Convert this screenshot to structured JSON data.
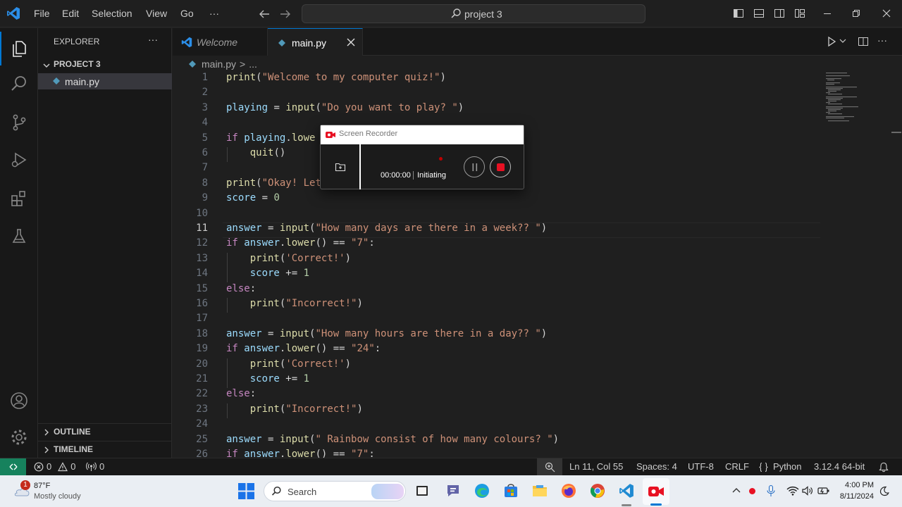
{
  "titlebar": {
    "menu": [
      "File",
      "Edit",
      "Selection",
      "View",
      "Go",
      "···"
    ],
    "search": "project 3"
  },
  "sidebar": {
    "title": "EXPLORER",
    "more": "···",
    "project": "PROJECT 3",
    "files": [
      "main.py"
    ],
    "outline": "OUTLINE",
    "timeline": "TIMELINE"
  },
  "tabs": [
    {
      "label": "Welcome",
      "active": false
    },
    {
      "label": "main.py",
      "active": true
    }
  ],
  "breadcrumb": {
    "file": "main.py",
    "sep": ">",
    "rest": "..."
  },
  "editor": {
    "active_line": 11,
    "lines": [
      {
        "n": "1",
        "t": [
          [
            "print",
            "f"
          ],
          [
            "(",
            "o"
          ],
          [
            "\"Welcome to my computer quiz!\"",
            "s"
          ],
          [
            ")",
            "o"
          ]
        ]
      },
      {
        "n": "2",
        "t": []
      },
      {
        "n": "3",
        "t": [
          [
            "playing",
            "v"
          ],
          [
            " = ",
            "o"
          ],
          [
            "input",
            "f"
          ],
          [
            "(",
            "o"
          ],
          [
            "\"Do you want to play? \"",
            "s"
          ],
          [
            ")",
            "o"
          ]
        ]
      },
      {
        "n": "4",
        "t": []
      },
      {
        "n": "5",
        "t": [
          [
            "if ",
            "k"
          ],
          [
            "playing",
            "v"
          ],
          [
            ".",
            "o"
          ],
          [
            "lowe",
            "f"
          ]
        ]
      },
      {
        "n": "6",
        "t": [
          [
            "    ",
            "o"
          ],
          [
            "quit",
            "f"
          ],
          [
            "()",
            "o"
          ]
        ]
      },
      {
        "n": "7",
        "t": []
      },
      {
        "n": "8",
        "t": [
          [
            "print",
            "f"
          ],
          [
            "(",
            "o"
          ],
          [
            "\"Okay! Let",
            "s"
          ]
        ]
      },
      {
        "n": "9",
        "t": [
          [
            "score",
            "v"
          ],
          [
            " = ",
            "o"
          ],
          [
            "0",
            "n"
          ]
        ]
      },
      {
        "n": "10",
        "t": []
      },
      {
        "n": "11",
        "t": [
          [
            "answer",
            "v"
          ],
          [
            " = ",
            "o"
          ],
          [
            "input",
            "f"
          ],
          [
            "(",
            "o"
          ],
          [
            "\"How many days are there in a week?? \"",
            "s"
          ],
          [
            ")",
            "o"
          ]
        ]
      },
      {
        "n": "12",
        "t": [
          [
            "if ",
            "k"
          ],
          [
            "answer",
            "v"
          ],
          [
            ".",
            "o"
          ],
          [
            "lower",
            "f"
          ],
          [
            "() == ",
            "o"
          ],
          [
            "\"7\"",
            "s"
          ],
          [
            ":",
            "o"
          ]
        ]
      },
      {
        "n": "13",
        "t": [
          [
            "    ",
            "o"
          ],
          [
            "print",
            "f"
          ],
          [
            "(",
            "o"
          ],
          [
            "'Correct!'",
            "s"
          ],
          [
            ")",
            "o"
          ]
        ]
      },
      {
        "n": "14",
        "t": [
          [
            "    ",
            "o"
          ],
          [
            "score",
            "v"
          ],
          [
            " += ",
            "o"
          ],
          [
            "1",
            "n"
          ]
        ]
      },
      {
        "n": "15",
        "t": [
          [
            "else",
            "k"
          ],
          [
            ":",
            "o"
          ]
        ]
      },
      {
        "n": "16",
        "t": [
          [
            "    ",
            "o"
          ],
          [
            "print",
            "f"
          ],
          [
            "(",
            "o"
          ],
          [
            "\"Incorrect!\"",
            "s"
          ],
          [
            ")",
            "o"
          ]
        ]
      },
      {
        "n": "17",
        "t": []
      },
      {
        "n": "18",
        "t": [
          [
            "answer",
            "v"
          ],
          [
            " = ",
            "o"
          ],
          [
            "input",
            "f"
          ],
          [
            "(",
            "o"
          ],
          [
            "\"How many hours are there in a day?? \"",
            "s"
          ],
          [
            ")",
            "o"
          ]
        ]
      },
      {
        "n": "19",
        "t": [
          [
            "if ",
            "k"
          ],
          [
            "answer",
            "v"
          ],
          [
            ".",
            "o"
          ],
          [
            "lower",
            "f"
          ],
          [
            "() == ",
            "o"
          ],
          [
            "\"24\"",
            "s"
          ],
          [
            ":",
            "o"
          ]
        ]
      },
      {
        "n": "20",
        "t": [
          [
            "    ",
            "o"
          ],
          [
            "print",
            "f"
          ],
          [
            "(",
            "o"
          ],
          [
            "'Correct!'",
            "s"
          ],
          [
            ")",
            "o"
          ]
        ]
      },
      {
        "n": "21",
        "t": [
          [
            "    ",
            "o"
          ],
          [
            "score",
            "v"
          ],
          [
            " += ",
            "o"
          ],
          [
            "1",
            "n"
          ]
        ]
      },
      {
        "n": "22",
        "t": [
          [
            "else",
            "k"
          ],
          [
            ":",
            "o"
          ]
        ]
      },
      {
        "n": "23",
        "t": [
          [
            "    ",
            "o"
          ],
          [
            "print",
            "f"
          ],
          [
            "(",
            "o"
          ],
          [
            "\"Incorrect!\"",
            "s"
          ],
          [
            ")",
            "o"
          ]
        ]
      },
      {
        "n": "24",
        "t": []
      },
      {
        "n": "25",
        "t": [
          [
            "answer",
            "v"
          ],
          [
            " = ",
            "o"
          ],
          [
            "input",
            "f"
          ],
          [
            "(",
            "o"
          ],
          [
            "\" Rainbow consist of how many colours? \"",
            "s"
          ],
          [
            ")",
            "o"
          ]
        ]
      },
      {
        "n": "26",
        "t": [
          [
            "if ",
            "k"
          ],
          [
            "answer",
            "v"
          ],
          [
            ".",
            "o"
          ],
          [
            "lower",
            "f"
          ],
          [
            "() == ",
            "o"
          ],
          [
            "\"7\"",
            "s"
          ],
          [
            ":",
            "o"
          ]
        ]
      }
    ]
  },
  "recorder": {
    "title": "Screen Recorder",
    "time": "00:00:00",
    "status": "Initiating"
  },
  "statusbar": {
    "errors": "0",
    "warnings": "0",
    "ports": "0",
    "position": "Ln 11, Col 55",
    "spaces": "Spaces: 4",
    "encoding": "UTF-8",
    "eol": "CRLF",
    "language": "Python",
    "interpreter": "3.12.4 64-bit"
  },
  "taskbar": {
    "temp": "87°F",
    "weather": "Mostly cloudy",
    "badge": "1",
    "search": "Search",
    "time": "4:00 PM",
    "date": "8/11/2024"
  },
  "colors": {
    "accent": "#0078d4",
    "remote": "#16825d",
    "record_red": "#e81123"
  }
}
